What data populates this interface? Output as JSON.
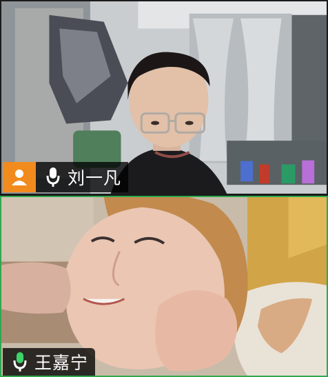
{
  "participants": [
    {
      "name": "刘一凡",
      "mic_status": "mic-icon",
      "avatar_icon": "person-icon",
      "avatar_color": "#f28b1e",
      "mic_color": "#ffffff",
      "active_speaker": false
    },
    {
      "name": "王嘉宁",
      "mic_status": "mic-icon",
      "mic_color": "#3dd26a",
      "active_speaker": true,
      "active_border_color": "#2fa84f"
    }
  ]
}
